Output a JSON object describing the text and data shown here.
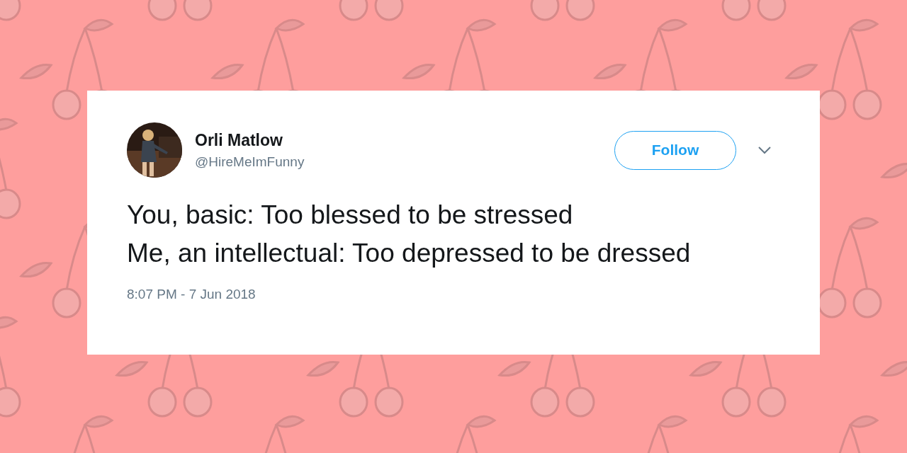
{
  "tweet": {
    "author_name": "Orli Matlow",
    "handle": "@HireMeImFunny",
    "follow_button": "Follow",
    "text": "You, basic: Too blessed to be stressed\nMe, an intellectual: Too depressed to be dressed",
    "timestamp": "8:07 PM - 7 Jun 2018"
  }
}
